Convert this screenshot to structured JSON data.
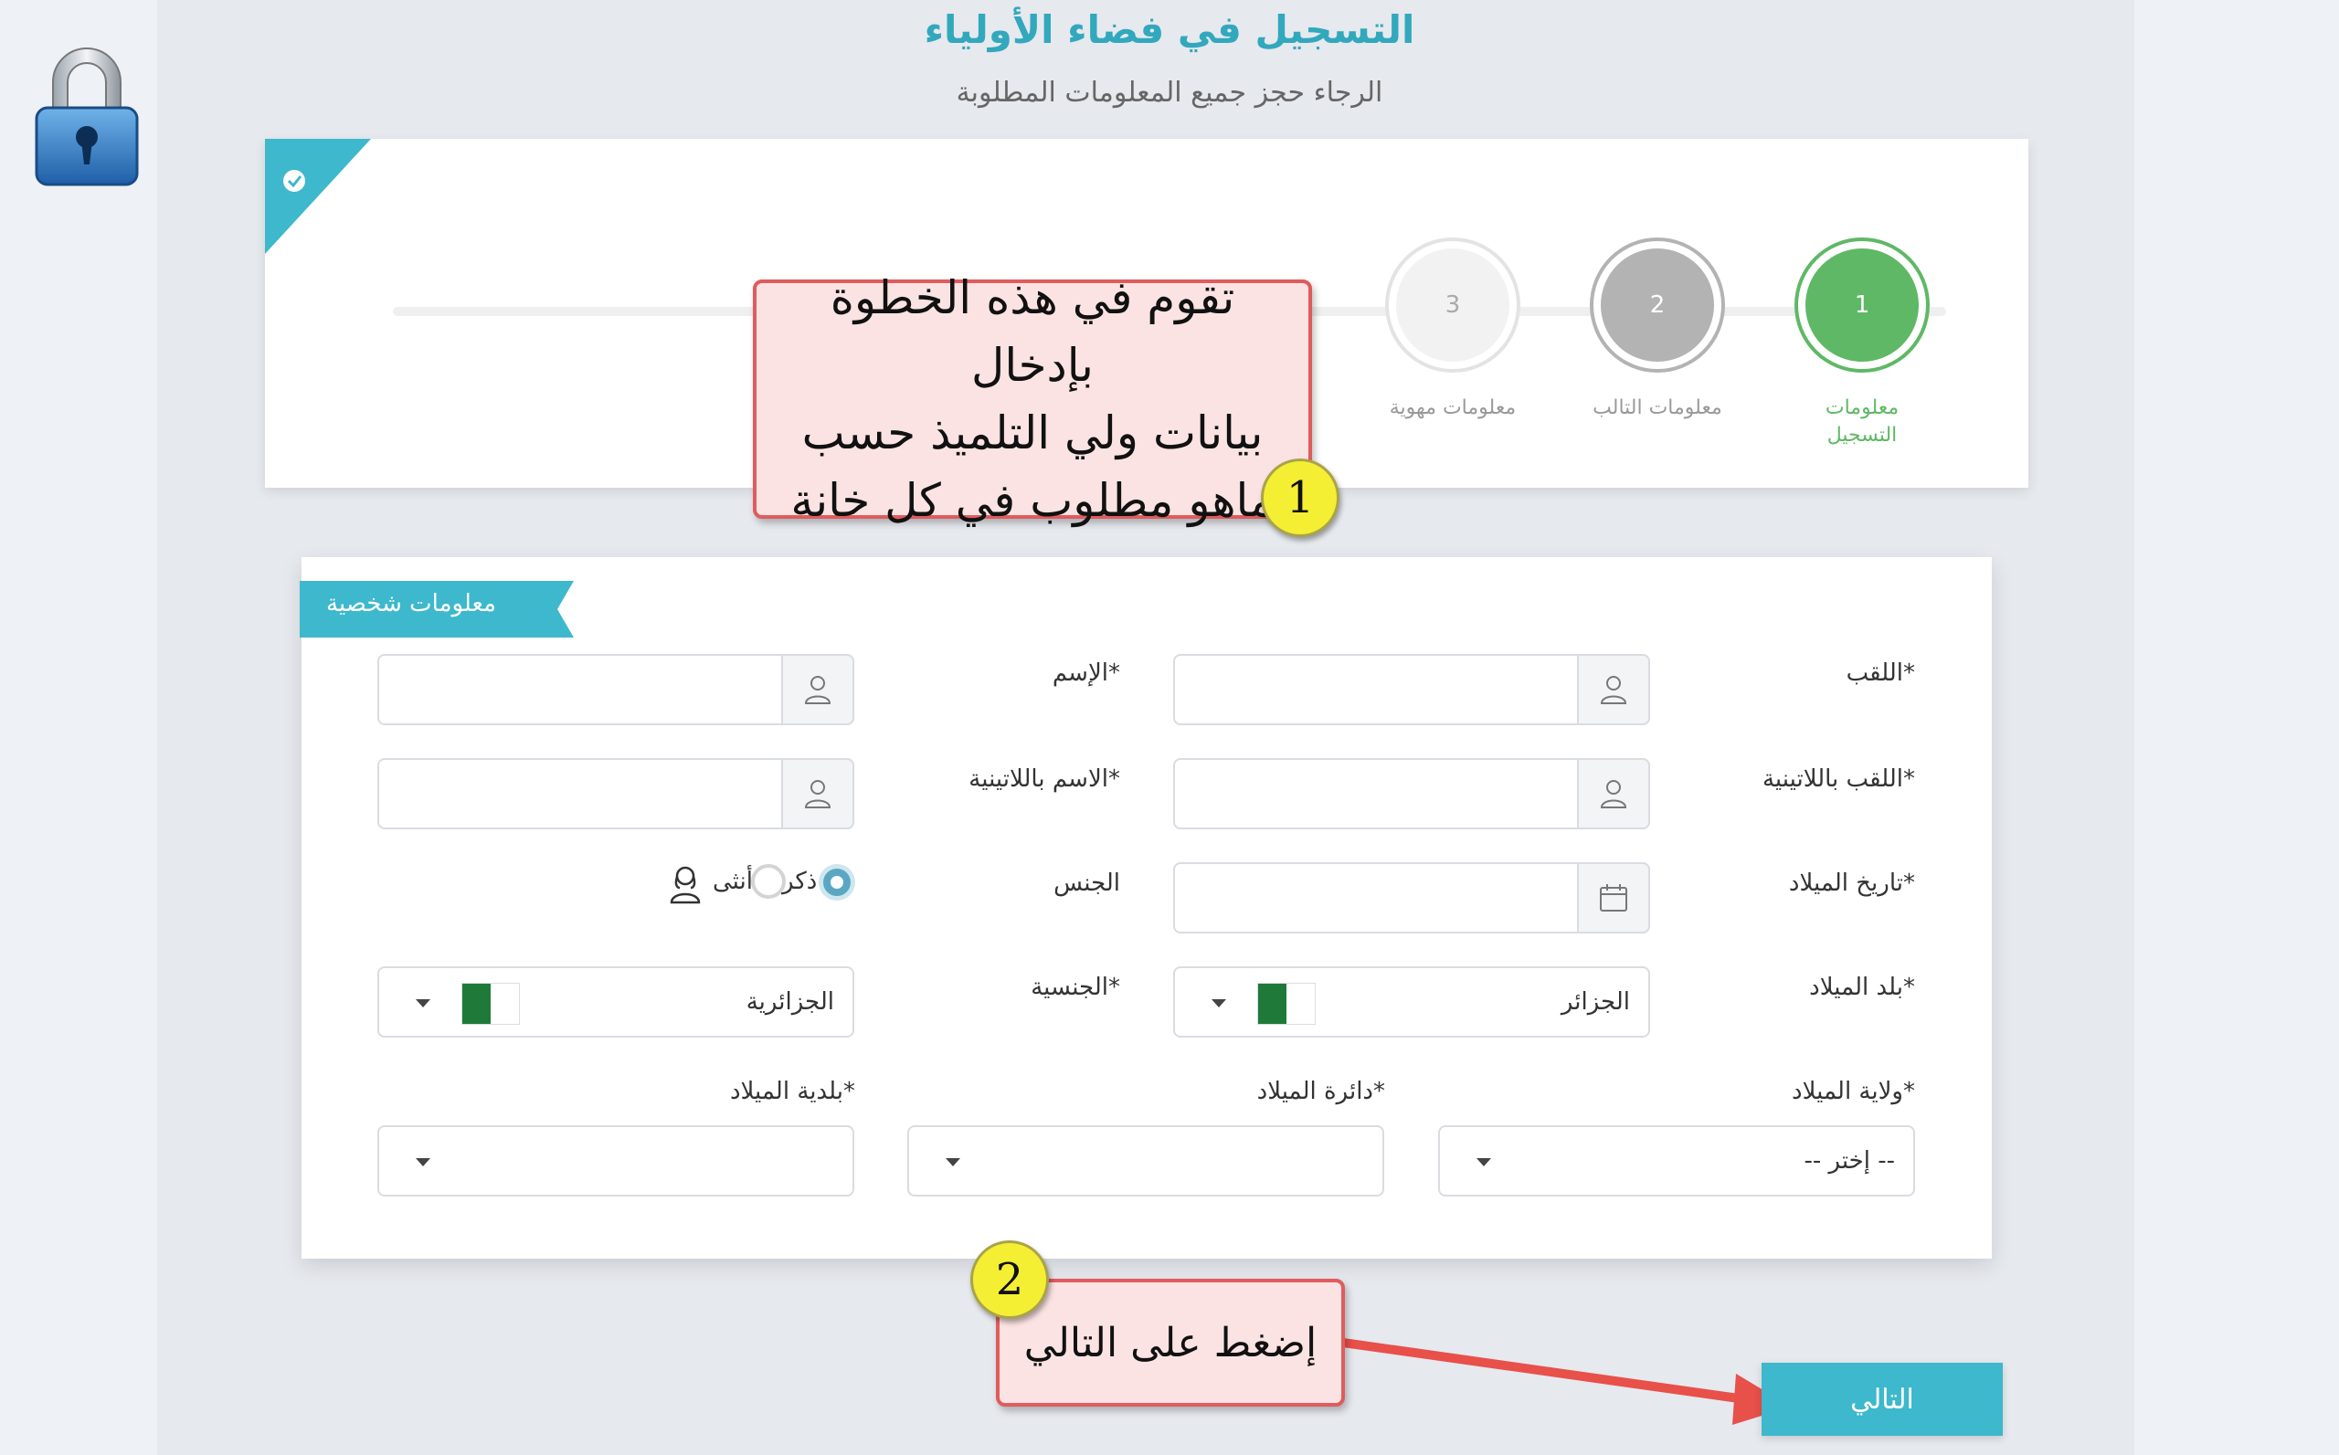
{
  "header": {
    "title": "التسجيل في فضاء الأولياء",
    "subtitle": "الرجاء حجز جميع المعلومات المطلوبة"
  },
  "stepper": {
    "steps": [
      {
        "number": "1",
        "label_line1": "معلومات",
        "label_line2": "التسجيل",
        "state": "active"
      },
      {
        "number": "2",
        "label_line1": "معلومات التالب",
        "label_line2": "",
        "state": "next"
      },
      {
        "number": "3",
        "label_line1": "معلومات مهوية",
        "label_line2": "",
        "state": "pending"
      }
    ]
  },
  "callouts": {
    "step1_text_lines": [
      "تقوم في هذه الخطوة بإدخال",
      "بيانات ولي التلميذ حسب",
      "ماهو مطلوب في كل خانة"
    ],
    "step1_badge": "1",
    "step2_text": "إضغط على التالي",
    "step2_badge": "2"
  },
  "form": {
    "section_title": "معلومات شخصية",
    "fields": {
      "surname_label": "اللقب*",
      "name_label": "الإسم*",
      "surname_latin_label": "اللقب باللاتينية*",
      "name_latin_label": "الاسم باللاتينية*",
      "birth_date_label": "تاريخ الميلاد*",
      "gender_label": "الجنس",
      "gender_options": {
        "male": "ذكر",
        "female": "أنثى",
        "selected": "male"
      },
      "birth_country_label": "بلد الميلاد*",
      "birth_country_value": "الجزائر",
      "nationality_label": "الجنسية*",
      "nationality_value": "الجزائرية",
      "birth_wilaya_label": "ولاية الميلاد*",
      "birth_wilaya_value": "-- إختر --",
      "birth_daira_label": "دائرة الميلاد*",
      "birth_daira_value": "",
      "birth_commune_label": "بلدية الميلاد*",
      "birth_commune_value": ""
    }
  },
  "actions": {
    "next_label": "التالي"
  },
  "colors": {
    "accent": "#3db8cc",
    "active_step": "#5fb865",
    "callout_border": "#e05c5c",
    "badge": "#f4ef33"
  }
}
